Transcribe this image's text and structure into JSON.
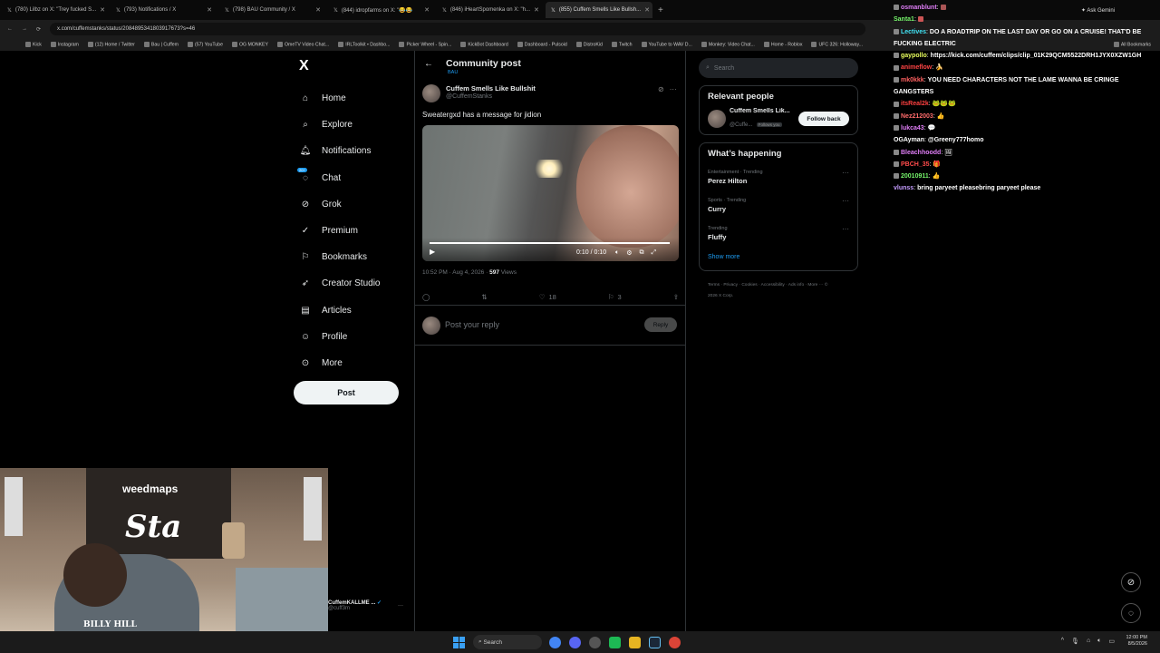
{
  "browser": {
    "tabs": [
      {
        "label": "(780) Lilbz on X: \"Trey fucked S..."
      },
      {
        "label": "(793) Notifications / X"
      },
      {
        "label": "(798) BAU Community / X"
      },
      {
        "label": "(844) idropfarms on X: \"😂😂"
      },
      {
        "label": "(846) iHeartSpomenka on X: \"h..."
      },
      {
        "label": "(855) Cuffem Smells Like Bullsh..."
      }
    ],
    "ask_gemini": "Ask Gemini",
    "url": "x.com/cuffemstanks/status/2084895341803917673?s=46",
    "bookmarks": [
      "Kick",
      "Instagram",
      "(12) Home / Twitter",
      "Bau | Cuffem",
      "(57) YouTube",
      "OG MONKEY",
      "OmeTV Video Chat...",
      "IRLToolkit • Dashbo...",
      "Picker Wheel - Spin...",
      "KickBot Dashboard",
      "Dashboard - Pulsoid",
      "DistroKid",
      "Twitch",
      "YouTube to WAV D...",
      "Monkey: Video Chat...",
      "Home - Roblox",
      "UFC 326: Holloway..."
    ],
    "all_bookmarks": "All Bookmarks"
  },
  "nav": {
    "logo": "X",
    "items": [
      {
        "label": "Home"
      },
      {
        "label": "Explore"
      },
      {
        "label": "Notifications"
      },
      {
        "label": "Chat"
      },
      {
        "label": "Grok"
      },
      {
        "label": "Premium"
      },
      {
        "label": "Bookmarks"
      },
      {
        "label": "Creator Studio"
      },
      {
        "label": "Articles"
      },
      {
        "label": "Profile"
      },
      {
        "label": "More"
      }
    ],
    "chat_badge": "20+",
    "post_label": "Post",
    "account_name": "CuffemKALLME ...",
    "account_handle": "@cuff3m"
  },
  "post": {
    "header_title": "Community post",
    "community": "BAU",
    "author_name": "Cuffem Smells Like Bullshit",
    "author_handle": "@CuffemStanks",
    "text": "Sweatergxd has a message for jidion",
    "video_time": "0:10 / 0:10",
    "timestamp": "10:52 PM · Aug 4, 2026 ·",
    "views_count": "597",
    "views_label": "Views",
    "likes": "18",
    "bookmarks_count": "3",
    "reply_placeholder": "Post your reply",
    "reply_button": "Reply"
  },
  "sidebar": {
    "search_placeholder": "Search",
    "relevant_title": "Relevant people",
    "relevant_name": "Cuffem Smells Lik...",
    "relevant_handle": "@Cuffe...",
    "follows_you": "Follows you",
    "follow_back": "Follow back",
    "happening_title": "What’s happening",
    "trends": [
      {
        "context": "Entertainment · Trending",
        "name": "Perez Hilton"
      },
      {
        "context": "Sports · Trending",
        "name": "Curry"
      },
      {
        "context": "Trending",
        "name": "Fluffy"
      }
    ],
    "show_more": "Show more",
    "footer": [
      "Terms",
      "Privacy",
      "Cookies",
      "Accessibility",
      "Ads info",
      "More ···",
      "© 2026 X Corp."
    ]
  },
  "chat": {
    "messages": [
      {
        "user": "osmanblunt",
        "color": "#e07ef7",
        "text": ""
      },
      {
        "user": "Santa1",
        "color": "#76f56b",
        "text": ""
      },
      {
        "user": "Lectives",
        "color": "#42e4f5",
        "text": "DO A ROADTRIP ON THE LAST DAY OR GO ON A CRUISE! THAT'D BE FUCKING ELECTRIC"
      },
      {
        "user": "gaypollo",
        "color": "#eaff5e",
        "text": "https://kick.com/cuffem/clips/clip_01K29QCM5522DRH1JYX0XZW1GH"
      },
      {
        "user": "animeflow",
        "color": "#ff4444",
        "text": "🍌"
      },
      {
        "user": "mk0kkk",
        "color": "#ff6060",
        "text": "YOU NEED CHARACTERS NOT THE LAME WANNA BE CRINGE GANGSTERS"
      },
      {
        "user": "itsReal2k",
        "color": "#ff4040",
        "text": "🐸🐸🐸"
      },
      {
        "user": "Nez212003",
        "color": "#ff6b6b",
        "text": "👍"
      },
      {
        "user": "lukca43",
        "color": "#e07ef7",
        "text": "💬"
      },
      {
        "user": "OGAyman",
        "color": "#ffffff",
        "text": "@Greeny777homo"
      },
      {
        "user": "Bleachhoodd",
        "color": "#e07ef7",
        "text": "🖼"
      },
      {
        "user": "PBCH_35",
        "color": "#ff4b4b",
        "text": "🎁"
      },
      {
        "user": "20010911",
        "color": "#76f56b",
        "text": "👍"
      },
      {
        "user": "vlunss",
        "color": "#c59cff",
        "text": "bring paryeet pleasebring paryeet please"
      }
    ]
  },
  "taskbar": {
    "search": "Search",
    "time": "12:00 PM",
    "date": "8/5/2026"
  },
  "webcam": {
    "sign": "weedmaps",
    "art_text": "Sta",
    "shirt_text": "BILLY HILL"
  },
  "colors": {
    "accent": "#1d9bf0",
    "background": "#000000"
  }
}
